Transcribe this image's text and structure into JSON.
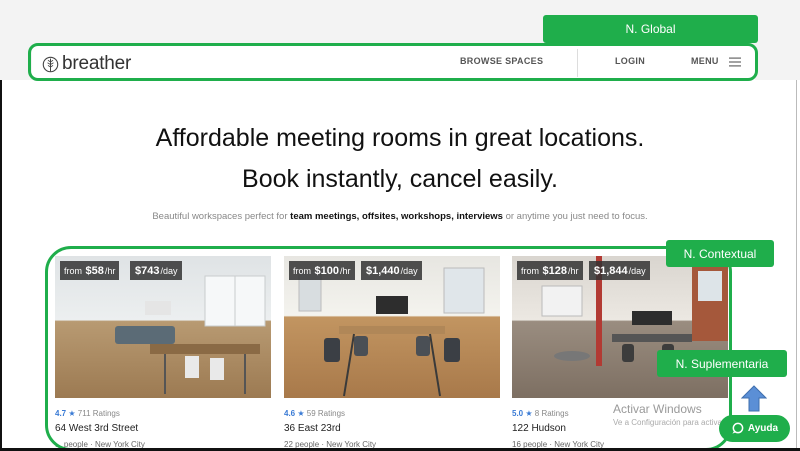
{
  "annotations": {
    "global": "N. Global",
    "contextual": "N. Contextual",
    "supplementary": "N. Suplementaria"
  },
  "header": {
    "logo_text": "breather",
    "browse": "BROWSE SPACES",
    "login": "LOGIN",
    "menu": "MENU"
  },
  "hero": {
    "line1": "Affordable meeting rooms in great locations.",
    "line2": "Book instantly, cancel easily.",
    "sub_pre": "Beautiful workspaces perfect for",
    "sub_b1": "team meetings,",
    "sub_b2": "offsites,",
    "sub_b3": "workshops,",
    "sub_b4": "interviews",
    "sub_post": "or anytime you just need to focus."
  },
  "cards": [
    {
      "from": "from",
      "hourly": "$58",
      "per_hr": "/hr",
      "daily": "$743",
      "per_day": "/day",
      "rating": "4.7",
      "star": "★",
      "ratings": "711 Ratings",
      "name": "64 West 3rd Street",
      "meta": "... people · New York City"
    },
    {
      "from": "from",
      "hourly": "$100",
      "per_hr": "/hr",
      "daily": "$1,440",
      "per_day": "/day",
      "rating": "4.6",
      "star": "★",
      "ratings": "59 Ratings",
      "name": "36 East 23rd",
      "meta": "22 people · New York City"
    },
    {
      "from": "from",
      "hourly": "$128",
      "per_hr": "/hr",
      "daily": "$1,844",
      "per_day": "/day",
      "rating": "5.0",
      "star": "★",
      "ratings": "8 Ratings",
      "name": "122 Hudson",
      "meta": "16 people · New York City"
    }
  ],
  "windows_watermark": {
    "title": "Activar Windows",
    "subtitle": "Ve a Configuración para activar Windows."
  },
  "help_button": "Ayuda",
  "colors": {
    "annotation": "#1fae4b",
    "rating": "#3a7bd5"
  }
}
